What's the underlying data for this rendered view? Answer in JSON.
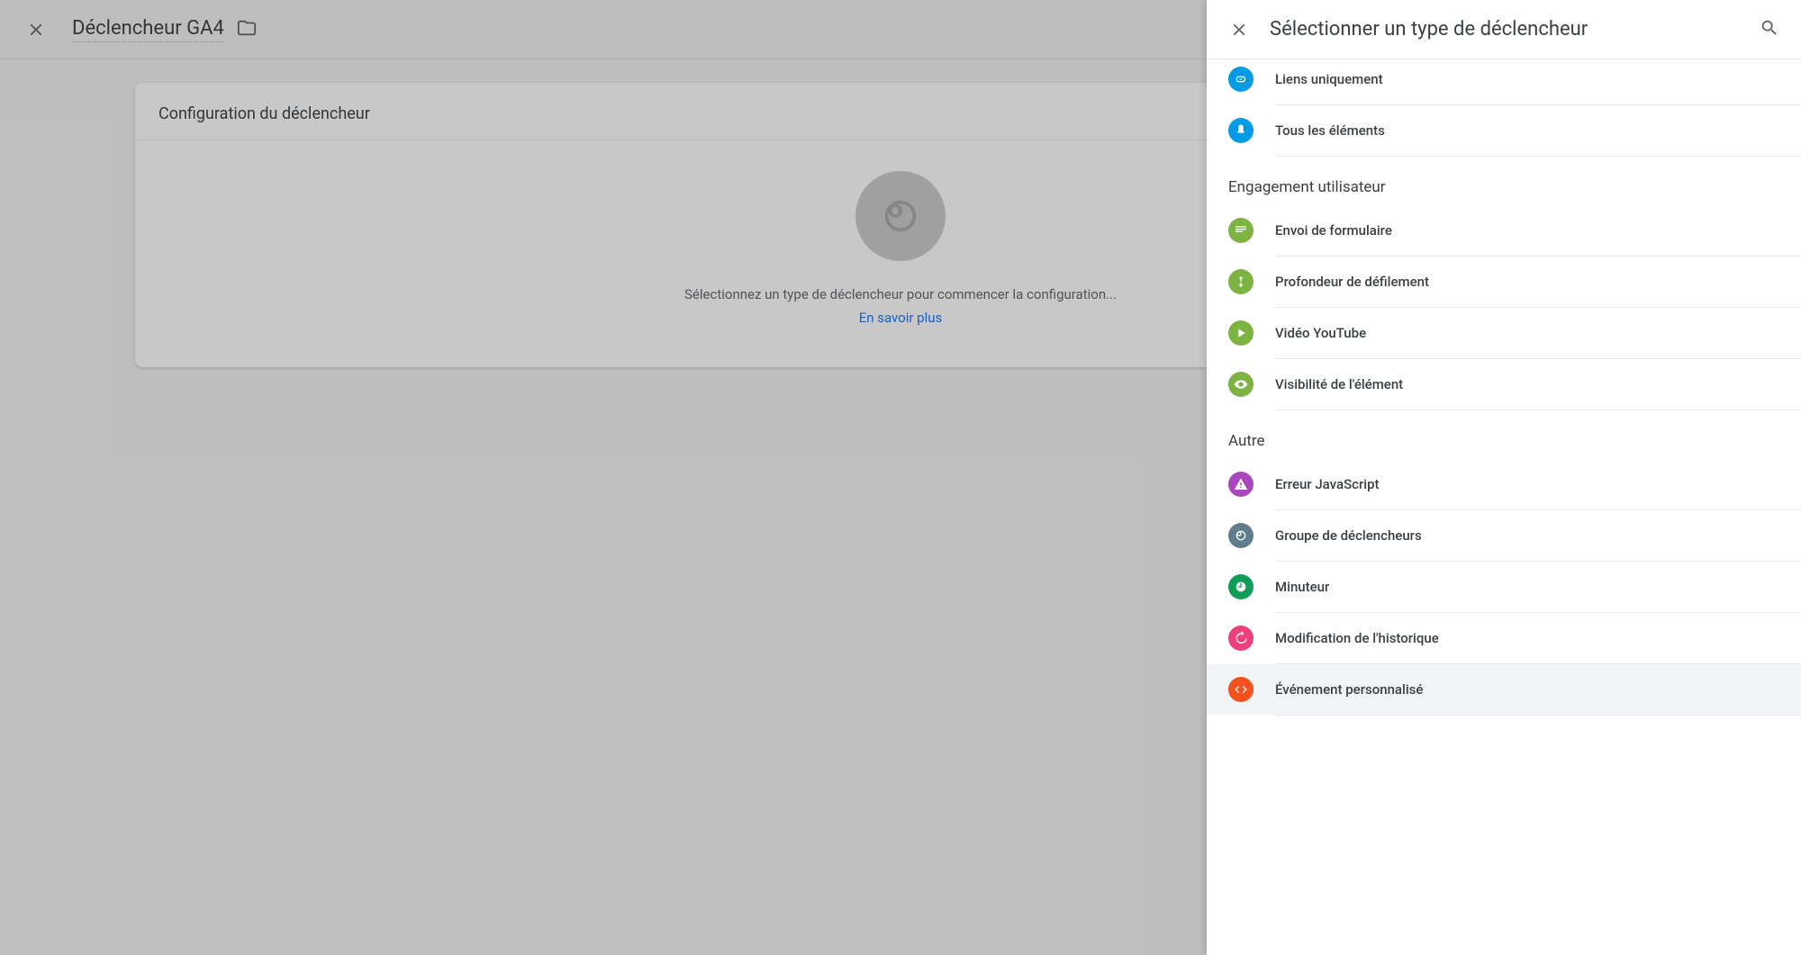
{
  "back": {
    "title": "Déclencheur GA4",
    "card_title": "Configuration du déclencheur",
    "placeholder_text": "Sélectionnez un type de déclencheur pour commencer la configuration...",
    "learn_more": "En savoir plus"
  },
  "panel": {
    "title": "Sélectionner un type de déclencheur",
    "partial_item": {
      "label": "Liens uniquement",
      "icon": "link",
      "color": "c-blue"
    },
    "click_items": [
      {
        "label": "Tous les éléments",
        "icon": "click",
        "color": "c-blue"
      }
    ],
    "categories": [
      {
        "title": "Engagement utilisateur",
        "items": [
          {
            "label": "Envoi de formulaire",
            "icon": "form",
            "color": "c-green"
          },
          {
            "label": "Profondeur de défilement",
            "icon": "scroll",
            "color": "c-green"
          },
          {
            "label": "Vidéo YouTube",
            "icon": "play",
            "color": "c-green"
          },
          {
            "label": "Visibilité de l'élément",
            "icon": "eye",
            "color": "c-green"
          }
        ]
      },
      {
        "title": "Autre",
        "items": [
          {
            "label": "Erreur JavaScript",
            "icon": "warn",
            "color": "c-purple"
          },
          {
            "label": "Groupe de déclencheurs",
            "icon": "group",
            "color": "c-slate"
          },
          {
            "label": "Minuteur",
            "icon": "timer",
            "color": "c-emerald"
          },
          {
            "label": "Modification de l'historique",
            "icon": "history",
            "color": "c-pink"
          },
          {
            "label": "Événement personnalisé",
            "icon": "code",
            "color": "c-orange",
            "selected": true
          }
        ]
      }
    ]
  }
}
